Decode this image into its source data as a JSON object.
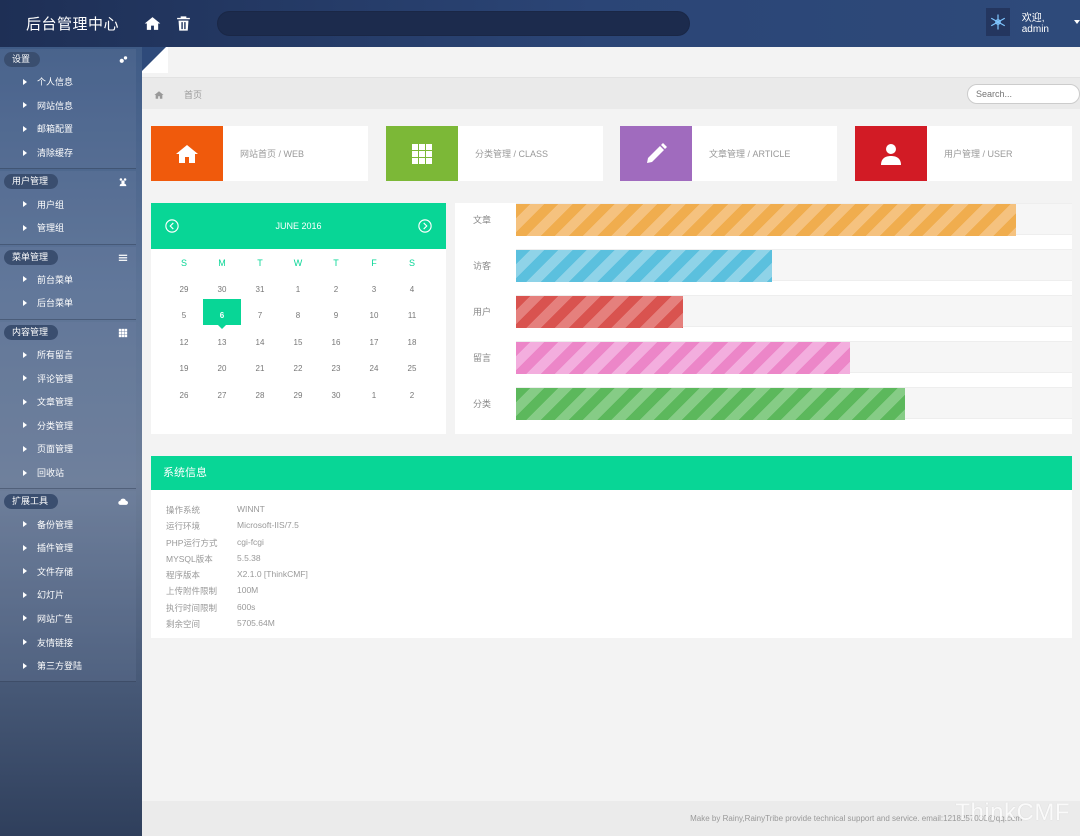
{
  "header": {
    "brand": "后台管理中心",
    "search_value": "",
    "welcome": "欢迎, admin"
  },
  "sidebar": {
    "sections": [
      {
        "title": "设置",
        "icon": "gears-icon",
        "items": [
          "个人信息",
          "网站信息",
          "邮箱配置",
          "清除缓存"
        ]
      },
      {
        "title": "用户管理",
        "icon": "users-icon",
        "items": [
          "用户组",
          "管理组"
        ]
      },
      {
        "title": "菜单管理",
        "icon": "list-icon",
        "items": [
          "前台菜单",
          "后台菜单"
        ]
      },
      {
        "title": "内容管理",
        "icon": "grid-icon",
        "items": [
          "所有留言",
          "评论管理",
          "文章管理",
          "分类管理",
          "页面管理",
          "回收站"
        ]
      },
      {
        "title": "扩展工具",
        "icon": "cloud-icon",
        "items": [
          "备份管理",
          "插件管理",
          "文件存储",
          "幻灯片",
          "网站广告",
          "友情链接",
          "第三方登陆"
        ]
      }
    ]
  },
  "breadcrumb": {
    "current": "首页"
  },
  "search": {
    "placeholder": "Search..."
  },
  "tiles": [
    {
      "label": "网站首页 / WEB",
      "color": "#f05a0c",
      "icon": "home-icon"
    },
    {
      "label": "分类管理 / CLASS",
      "color": "#7cb837",
      "icon": "grid-icon"
    },
    {
      "label": "文章管理 / ARTICLE",
      "color": "#a06bbe",
      "icon": "pencil-icon"
    },
    {
      "label": "用户管理 / USER",
      "color": "#d21b25",
      "icon": "user-icon"
    }
  ],
  "calendar": {
    "title": "JUNE 2016",
    "accent": "#08d696",
    "weekdays": [
      "S",
      "M",
      "T",
      "W",
      "T",
      "F",
      "S"
    ],
    "weeks": [
      [
        "29",
        "30",
        "31",
        "1",
        "2",
        "3",
        "4"
      ],
      [
        "5",
        "6",
        "7",
        "8",
        "9",
        "10",
        "11"
      ],
      [
        "12",
        "13",
        "14",
        "15",
        "16",
        "17",
        "18"
      ],
      [
        "19",
        "20",
        "21",
        "22",
        "23",
        "24",
        "25"
      ],
      [
        "26",
        "27",
        "28",
        "29",
        "30",
        "1",
        "2"
      ]
    ],
    "selected": "6"
  },
  "stats": [
    {
      "label": "文章",
      "value": 0.9,
      "color": "#f0ad4e",
      "stripe": "#f5c27f"
    },
    {
      "label": "访客",
      "value": 0.46,
      "color": "#5bc0de",
      "stripe": "#8fd3e8"
    },
    {
      "label": "用户",
      "value": 0.3,
      "color": "#d9534f",
      "stripe": "#e5807d"
    },
    {
      "label": "留言",
      "value": 0.6,
      "color": "#ec86c8",
      "stripe": "#f3aede"
    },
    {
      "label": "分类",
      "value": 0.7,
      "color": "#5cb85c",
      "stripe": "#86cc86"
    }
  ],
  "system": {
    "title": "系统信息",
    "rows": [
      {
        "k": "操作系统",
        "v": "WINNT"
      },
      {
        "k": "运行环境",
        "v": "Microsoft-IIS/7.5"
      },
      {
        "k": "PHP运行方式",
        "v": "cgi-fcgi"
      },
      {
        "k": "MYSQL版本",
        "v": "5.5.38"
      },
      {
        "k": "程序版本",
        "v": "X2.1.0    [ThinkCMF]"
      },
      {
        "k": "上传附件限制",
        "v": "100M"
      },
      {
        "k": "执行时间限制",
        "v": "600s"
      },
      {
        "k": "剩余空间",
        "v": "5705.64M"
      }
    ]
  },
  "footer": {
    "text": "Make by Rainy,RainyTribe provide technical support and service. email:1218257030@qq.com",
    "watermark": "ThinkCMF"
  }
}
